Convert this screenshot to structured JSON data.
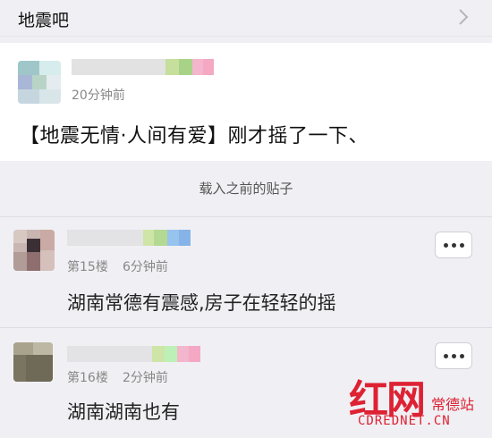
{
  "header": {
    "title": "地震吧"
  },
  "post": {
    "time": "20分钟前",
    "text": "【地震无情·人间有爱】刚才摇了一下、"
  },
  "divider": {
    "label": "载入之前的贴子"
  },
  "replies": [
    {
      "floor": "第15楼",
      "time": "6分钟前",
      "text": "湖南常德有震感,房子在轻轻的摇"
    },
    {
      "floor": "第16楼",
      "time": "2分钟前",
      "text": "湖南湖南也有"
    }
  ],
  "watermark": {
    "logo": "红网",
    "sub": "常德站",
    "url": "CDREDNET.CN"
  },
  "icons": {
    "chevron": "chevron-right-icon",
    "more": "more-dots-icon"
  },
  "colors": {
    "background": "#f0f0f4",
    "accent_red": "#dd2233"
  }
}
